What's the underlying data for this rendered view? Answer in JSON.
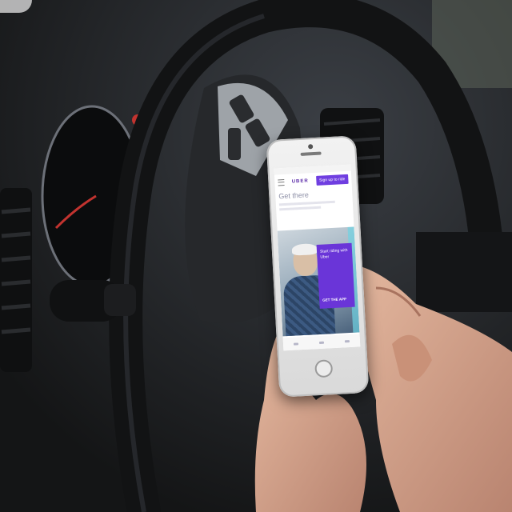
{
  "scene": {
    "subject": "hand-using-smartphone-in-car",
    "colors": {
      "interior": "#1e2023",
      "wheel": "#141516",
      "skin": "#d6a88e",
      "accent_purple": "#6f3ee0"
    }
  },
  "phone_screen": {
    "brand": "UBER",
    "signup_label": "Sign up to ride",
    "headline": "Get there",
    "promo_text": "Start riding with Uber",
    "promo_cta": "GET THE APP"
  },
  "icons": [
    "menu-icon",
    "home-button"
  ]
}
